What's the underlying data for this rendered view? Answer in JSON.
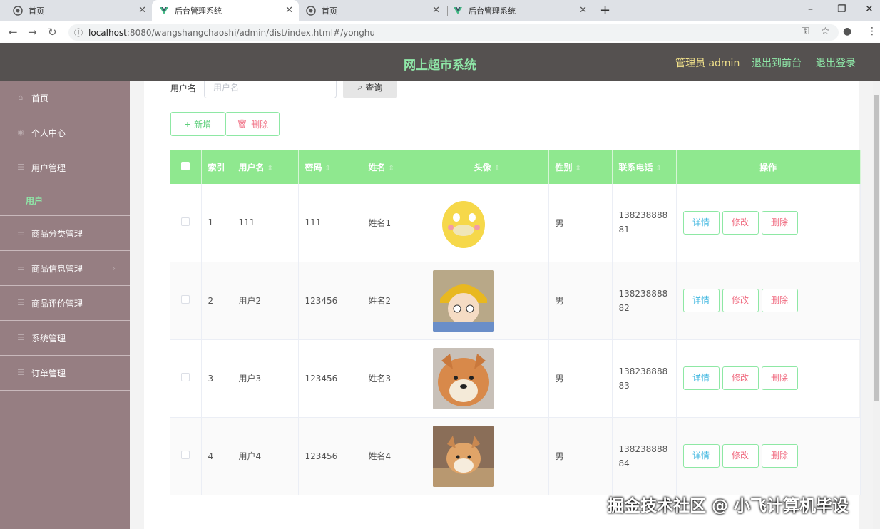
{
  "browser": {
    "tabs": [
      {
        "label": "首页",
        "icon": "globe-icon",
        "active": false
      },
      {
        "label": "后台管理系统",
        "icon": "vue-logo-icon",
        "active": true
      },
      {
        "label": "首页",
        "icon": "globe-icon",
        "active": false
      },
      {
        "label": "后台管理系统",
        "icon": "vue-logo-icon",
        "active": false
      }
    ],
    "url_host": "localhost",
    "url_path": ":8080/wangshangchaoshi/admin/dist/index.html#/yonghu"
  },
  "header": {
    "title": "网上超市系统",
    "admin": "管理员 admin",
    "front_link": "退出到前台",
    "logout_link": "退出登录"
  },
  "sidebar": {
    "items": [
      {
        "label": "首页",
        "icon": "home-icon"
      },
      {
        "label": "个人中心",
        "icon": "user-icon"
      },
      {
        "label": "用户管理",
        "icon": "menu-icon"
      },
      {
        "label": "用户",
        "sub": true
      },
      {
        "label": "商品分类管理",
        "icon": "menu-icon"
      },
      {
        "label": "商品信息管理",
        "icon": "menu-icon"
      },
      {
        "label": "商品评价管理",
        "icon": "menu-icon"
      },
      {
        "label": "系统管理",
        "icon": "menu-icon"
      },
      {
        "label": "订单管理",
        "icon": "menu-icon"
      }
    ]
  },
  "search": {
    "label": "用户名",
    "placeholder": "用户名",
    "button": "查询"
  },
  "toolbar": {
    "add": "新增",
    "delete": "删除"
  },
  "table": {
    "headers": [
      "索引",
      "用户名",
      "密码",
      "姓名",
      "头像",
      "性别",
      "联系电话",
      "操作"
    ],
    "actions": {
      "detail": "详情",
      "edit": "修改",
      "delete": "删除"
    },
    "rows": [
      {
        "index": "1",
        "username": "111",
        "password": "111",
        "name": "姓名1",
        "avatar": "yellow duck cartoon",
        "gender": "男",
        "phone": "13823888881"
      },
      {
        "index": "2",
        "username": "用户2",
        "password": "123456",
        "name": "姓名2",
        "avatar": "anime boy with hat",
        "gender": "男",
        "phone": "13823888882"
      },
      {
        "index": "3",
        "username": "用户3",
        "password": "123456",
        "name": "姓名3",
        "avatar": "shiba dog",
        "gender": "男",
        "phone": "13823888883"
      },
      {
        "index": "4",
        "username": "用户4",
        "password": "123456",
        "name": "姓名4",
        "avatar": "shiba puppy",
        "gender": "男",
        "phone": "13823888884"
      }
    ]
  },
  "watermark": "掘金技术社区 @ 小飞计算机毕设"
}
